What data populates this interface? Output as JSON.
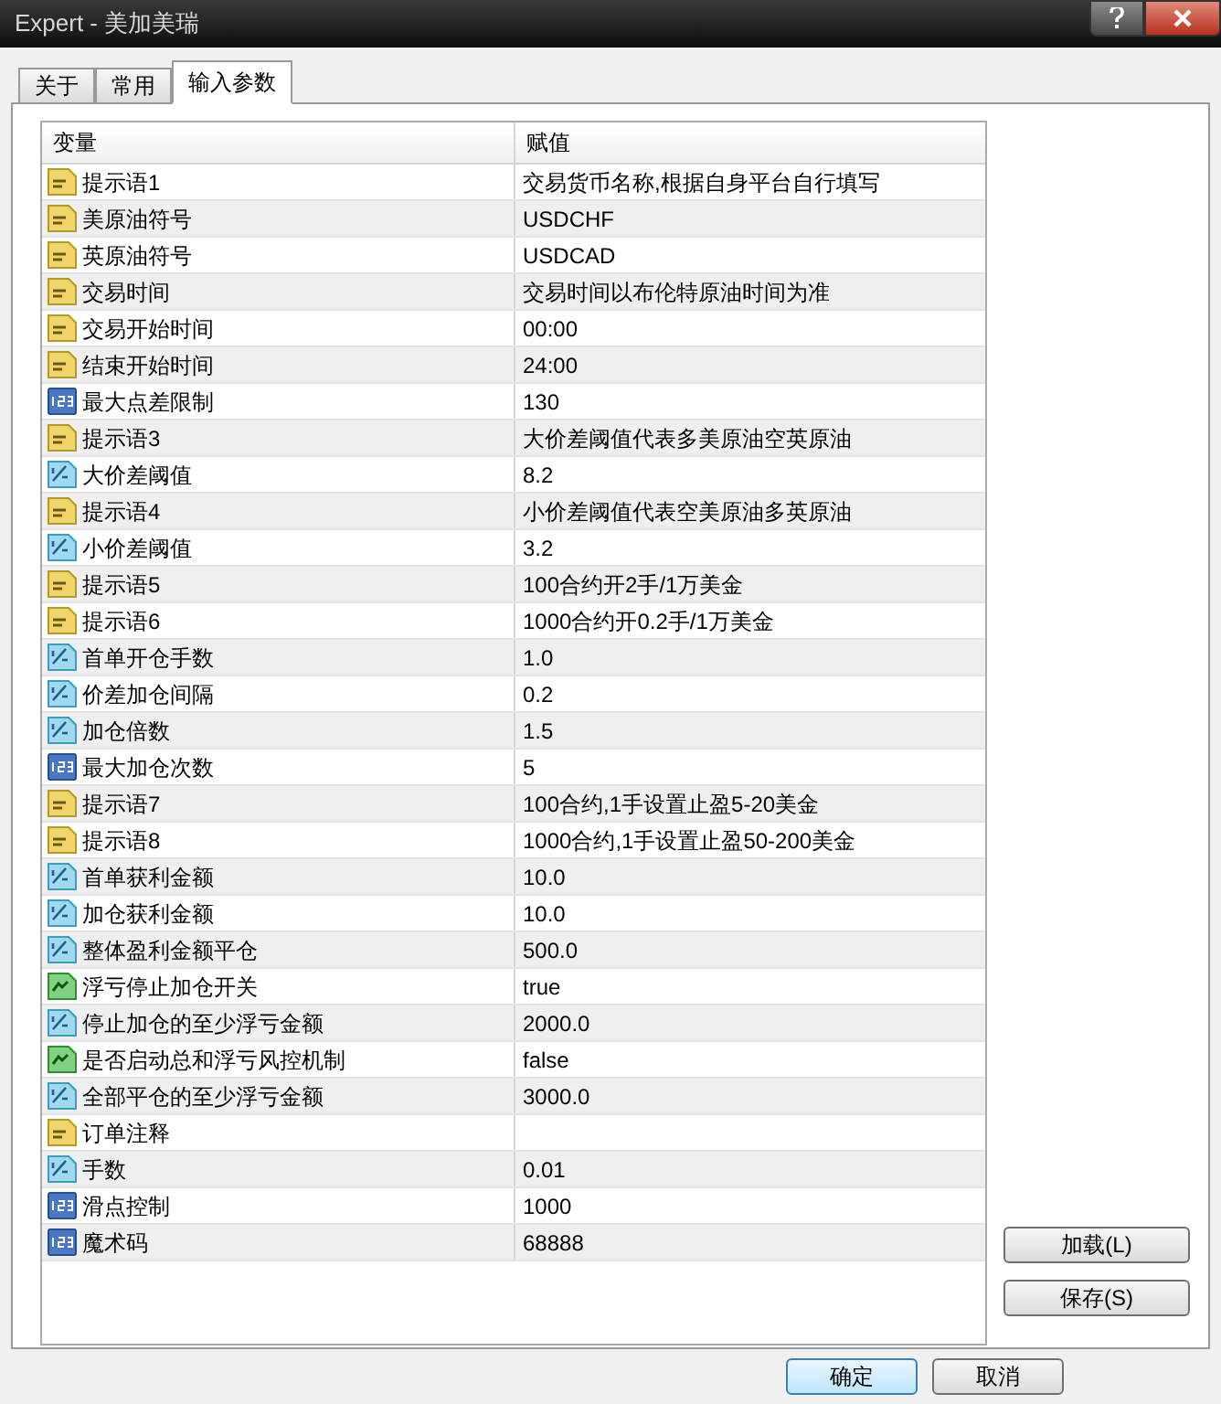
{
  "window": {
    "title": "Expert - 美加美瑞"
  },
  "tabs": [
    {
      "label": "关于",
      "selected": false
    },
    {
      "label": "常用",
      "selected": false
    },
    {
      "label": "输入参数",
      "selected": true
    }
  ],
  "table": {
    "columns": [
      "变量",
      "赋值"
    ],
    "rows": [
      {
        "kind": "string",
        "name": "提示语1",
        "value": "交易货币名称,根据自身平台自行填写"
      },
      {
        "kind": "string",
        "name": "美原油符号",
        "value": "USDCHF"
      },
      {
        "kind": "string",
        "name": "英原油符号",
        "value": "USDCAD"
      },
      {
        "kind": "string",
        "name": "交易时间",
        "value": "交易时间以布伦特原油时间为准"
      },
      {
        "kind": "string",
        "name": "交易开始时间",
        "value": "00:00"
      },
      {
        "kind": "string",
        "name": "结束开始时间",
        "value": "24:00"
      },
      {
        "kind": "int",
        "name": "最大点差限制",
        "value": "130"
      },
      {
        "kind": "string",
        "name": "提示语3",
        "value": "大价差阈值代表多美原油空英原油"
      },
      {
        "kind": "double",
        "name": "大价差阈值",
        "value": "8.2"
      },
      {
        "kind": "string",
        "name": "提示语4",
        "value": "小价差阈值代表空美原油多英原油"
      },
      {
        "kind": "double",
        "name": "小价差阈值",
        "value": "3.2"
      },
      {
        "kind": "string",
        "name": "提示语5",
        "value": "100合约开2手/1万美金"
      },
      {
        "kind": "string",
        "name": "提示语6",
        "value": "1000合约开0.2手/1万美金"
      },
      {
        "kind": "double",
        "name": "首单开仓手数",
        "value": "1.0"
      },
      {
        "kind": "double",
        "name": "价差加仓间隔",
        "value": "0.2"
      },
      {
        "kind": "double",
        "name": "加仓倍数",
        "value": "1.5"
      },
      {
        "kind": "int",
        "name": "最大加仓次数",
        "value": "5"
      },
      {
        "kind": "string",
        "name": "提示语7",
        "value": "100合约,1手设置止盈5-20美金"
      },
      {
        "kind": "string",
        "name": "提示语8",
        "value": "1000合约,1手设置止盈50-200美金"
      },
      {
        "kind": "double",
        "name": "首单获利金额",
        "value": "10.0"
      },
      {
        "kind": "double",
        "name": "加仓获利金额",
        "value": "10.0"
      },
      {
        "kind": "double",
        "name": "整体盈利金额平仓",
        "value": "500.0"
      },
      {
        "kind": "bool",
        "name": "浮亏停止加仓开关",
        "value": "true"
      },
      {
        "kind": "double",
        "name": "停止加仓的至少浮亏金额",
        "value": "2000.0"
      },
      {
        "kind": "bool",
        "name": "是否启动总和浮亏风控机制",
        "value": "false"
      },
      {
        "kind": "double",
        "name": "全部平仓的至少浮亏金额",
        "value": "3000.0"
      },
      {
        "kind": "string",
        "name": "订单注释"
      },
      {
        "kind": "double",
        "name": "手数",
        "value": "0.01"
      },
      {
        "kind": "int",
        "name": "滑点控制",
        "value": "1000"
      },
      {
        "kind": "int",
        "name": "魔术码",
        "value": "68888"
      }
    ]
  },
  "side_buttons": [
    "加载(L)",
    "保存(S)"
  ],
  "footer_buttons": [
    "确定",
    "取消"
  ]
}
